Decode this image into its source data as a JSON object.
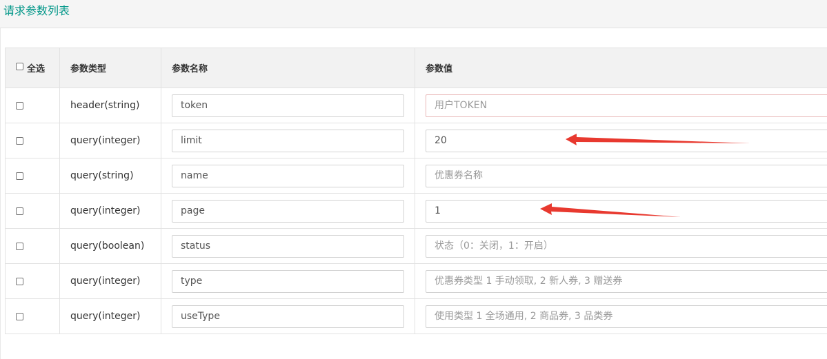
{
  "panel": {
    "title": "请求参数列表"
  },
  "table": {
    "headers": {
      "select_all": "全选",
      "param_type": "参数类型",
      "param_name": "参数名称",
      "param_value": "参数值"
    },
    "rows": [
      {
        "type": "header(string)",
        "name": "token",
        "value": "",
        "placeholder": "用户TOKEN",
        "checked": false
      },
      {
        "type": "query(integer)",
        "name": "limit",
        "value": "20",
        "placeholder": "",
        "checked": false
      },
      {
        "type": "query(string)",
        "name": "name",
        "value": "",
        "placeholder": "优惠券名称",
        "checked": false
      },
      {
        "type": "query(integer)",
        "name": "page",
        "value": "1",
        "placeholder": "",
        "checked": false
      },
      {
        "type": "query(boolean)",
        "name": "status",
        "value": "",
        "placeholder": "状态（0：关闭，1：开启）",
        "checked": false
      },
      {
        "type": "query(integer)",
        "name": "type",
        "value": "",
        "placeholder": "优惠券类型 1 手动领取, 2 新人券, 3 赠送券",
        "checked": false
      },
      {
        "type": "query(integer)",
        "name": "useType",
        "value": "",
        "placeholder": "使用类型 1 全场通用, 2 商品券, 3 品类券",
        "checked": false
      }
    ]
  },
  "annotations": {
    "arrow_color": "#e8392f"
  }
}
